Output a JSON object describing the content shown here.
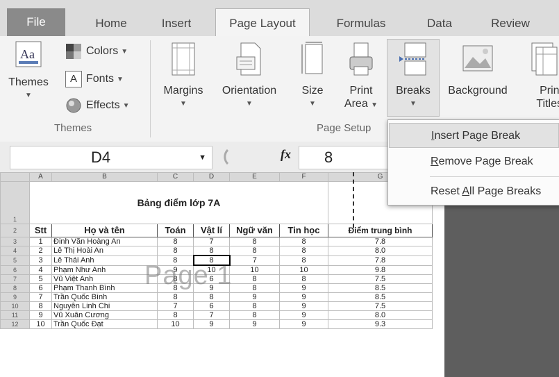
{
  "tabs": [
    "File",
    "Home",
    "Insert",
    "Page Layout",
    "Formulas",
    "Data",
    "Review"
  ],
  "active_tab": "Page Layout",
  "ribbon": {
    "themes_group": {
      "label": "Themes",
      "themes_button": "Themes",
      "colors": "Colors",
      "fonts": "Fonts",
      "effects": "Effects"
    },
    "page_setup_group": {
      "label": "Page Setup",
      "margins": "Margins",
      "orientation": "Orientation",
      "size": "Size",
      "print_area_1": "Print",
      "print_area_2": "Area",
      "breaks": "Breaks",
      "background": "Background",
      "print_titles_1": "Print",
      "print_titles_2": "Titles"
    }
  },
  "formula_bar": {
    "name_box": "D4",
    "fx": "fx",
    "value": "8"
  },
  "breaks_menu": {
    "items": [
      {
        "pre": "",
        "key": "I",
        "post": "nsert Page Break"
      },
      {
        "pre": "",
        "key": "R",
        "post": "emove Page Break"
      },
      {
        "pre": "Reset ",
        "key": "A",
        "post": "ll Page Breaks"
      }
    ]
  },
  "sheet": {
    "col_headers": [
      "A",
      "B",
      "C",
      "D",
      "E",
      "F",
      "G"
    ],
    "title": "Bảng điểm lớp 7A",
    "headers": [
      "Stt",
      "Họ và tên",
      "Toán",
      "Vật lí",
      "Ngữ văn",
      "Tin học",
      "Điểm trung bình"
    ],
    "rows": [
      [
        "1",
        "Đinh Văn Hoàng An",
        "8",
        "7",
        "8",
        "8",
        "7.8"
      ],
      [
        "2",
        "Lê Thị Hoài An",
        "8",
        "8",
        "8",
        "8",
        "8.0"
      ],
      [
        "3",
        "Lê Thái Anh",
        "8",
        "8",
        "7",
        "8",
        "7.8"
      ],
      [
        "4",
        "Phạm Như Anh",
        "9",
        "10",
        "10",
        "10",
        "9.8"
      ],
      [
        "5",
        "Vũ Việt Anh",
        "8",
        "6",
        "8",
        "8",
        "7.5"
      ],
      [
        "6",
        "Phạm Thanh Bình",
        "8",
        "9",
        "8",
        "9",
        "8.5"
      ],
      [
        "7",
        "Trần Quốc Bình",
        "8",
        "8",
        "9",
        "9",
        "8.5"
      ],
      [
        "8",
        "Nguyễn Linh Chi",
        "7",
        "6",
        "8",
        "9",
        "7.5"
      ],
      [
        "9",
        "Vũ Xuân Cương",
        "8",
        "7",
        "8",
        "9",
        "8.0"
      ],
      [
        "10",
        "Trần Quốc Đạt",
        "10",
        "9",
        "9",
        "9",
        "9.3"
      ]
    ],
    "row_numbers": [
      "1",
      "2",
      "3",
      "4",
      "5",
      "6",
      "7",
      "8",
      "9",
      "10",
      "11",
      "12"
    ],
    "watermark": "Page 1"
  }
}
